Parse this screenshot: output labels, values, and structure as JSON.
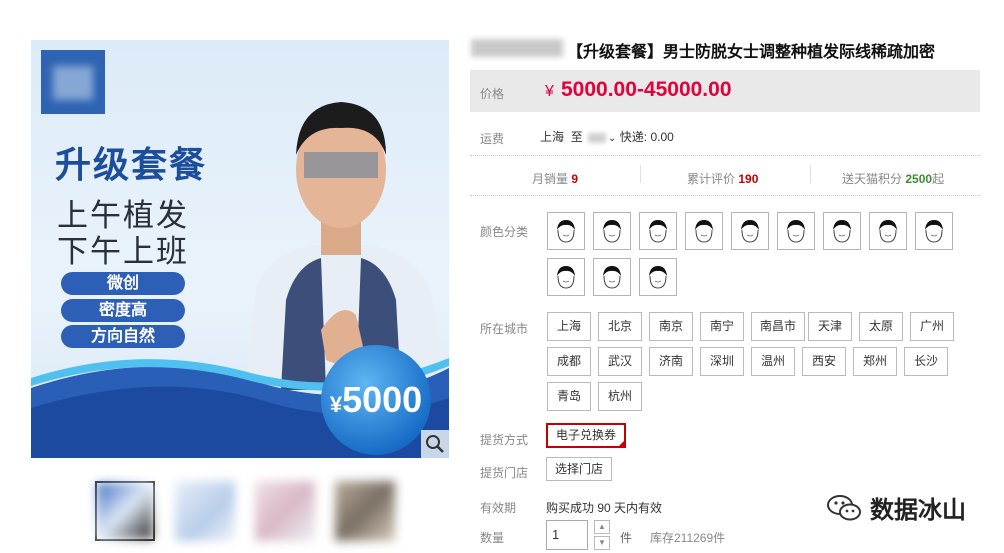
{
  "gallery": {
    "headline": "升级套餐",
    "slogan_1": "上午植发",
    "slogan_2": "下午上班",
    "tags": [
      "微创",
      "密度高",
      "方向自然"
    ],
    "price_badge_symbol": "¥",
    "price_badge_value": "5000",
    "zoom_icon": "magnifier-icon"
  },
  "product": {
    "title": "【升级套餐】男士防脱女士调整种植发际线稀疏加密"
  },
  "price": {
    "label": "价格",
    "currency": "¥",
    "value": "5000.00-45000.00",
    "color": "#e4003a"
  },
  "shipping": {
    "label": "运费",
    "from": "上海",
    "to_word": "至",
    "express": "快递: 0.00"
  },
  "stats": {
    "monthly_sales_label": "月销量",
    "monthly_sales_value": "9",
    "reviews_label": "累计评价",
    "reviews_value": "190",
    "points_label": "送天猫积分",
    "points_value": "2500",
    "points_suffix": "起"
  },
  "color_category": {
    "label": "颜色分类",
    "swatch_count": 12
  },
  "city": {
    "label": "所在城市",
    "options": [
      "上海",
      "北京",
      "南京",
      "南宁",
      "南昌市",
      "天津",
      "太原",
      "广州",
      "成都",
      "武汉",
      "济南",
      "深圳",
      "温州",
      "西安",
      "郑州",
      "长沙",
      "青岛",
      "杭州"
    ]
  },
  "pickup_method": {
    "label": "提货方式",
    "selected": "电子兑换券"
  },
  "pickup_store": {
    "label": "提货门店",
    "button": "选择门店"
  },
  "validity": {
    "label": "有效期",
    "value": "购买成功 90 天内有效"
  },
  "quantity": {
    "label": "数量",
    "value": "1",
    "unit": "件",
    "stock": "库存211269件"
  },
  "watermark": {
    "text": "数据冰山"
  }
}
